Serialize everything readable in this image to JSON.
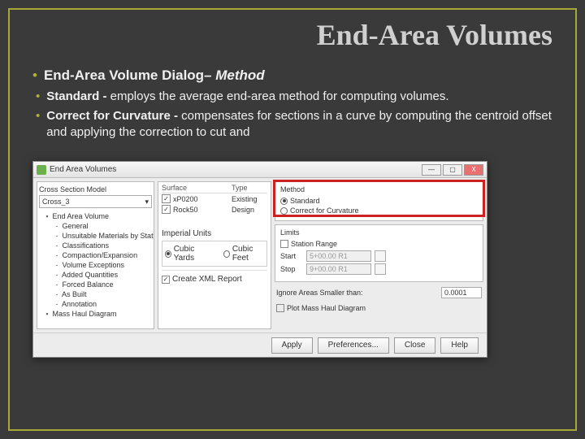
{
  "slide": {
    "title": "End-Area Volumes",
    "b1_label": "End-Area Volume Dialog– ",
    "b1_method": "Method",
    "b2_bold": "Standard - ",
    "b2_text": "employs the average end-area method for computing volumes.",
    "b3_bold": "Correct for Curvature - ",
    "b3_text": "compensates for sections in a curve by computing the centroid offset and applying the correction to cut and"
  },
  "dialog": {
    "title": "End Area Volumes",
    "winbtns": {
      "min": "—",
      "max": "▢",
      "close": "X"
    },
    "tree": {
      "label": "Cross Section Model",
      "select_value": "Cross_3",
      "root": "End Area Volume",
      "children": [
        "General",
        "Unsuitable Materials by Station",
        "Classifications",
        "Compaction/Expansion",
        "Volume Exceptions",
        "Added Quantities",
        "Forced Balance",
        "As Built",
        "Annotation",
        "Mass Haul Diagram"
      ]
    },
    "surfaces": {
      "head_surface": "Surface",
      "head_type": "Type",
      "rows": [
        {
          "checked": true,
          "name": "xP0200",
          "type": "Existing"
        },
        {
          "checked": true,
          "name": "Rock50",
          "type": "Design"
        }
      ]
    },
    "method": {
      "group": "Method",
      "standard": "Standard",
      "correct": "Correct for Curvature"
    },
    "limits": {
      "group": "Limits",
      "station_range": "Station Range",
      "start_label": "Start",
      "stop_label": "Stop",
      "start_value": "5+00.00 R1",
      "stop_value": "9+00.00 R1"
    },
    "units": {
      "group": "Imperial Units",
      "cy": "Cubic Yards",
      "cf": "Cubic Feet"
    },
    "ignore": {
      "label": "Ignore Areas Smaller than:",
      "value": "0.0001"
    },
    "createxml": "Create XML Report",
    "plotmass": "Plot Mass Haul Diagram",
    "buttons": {
      "apply": "Apply",
      "prefs": "Preferences...",
      "close": "Close",
      "help": "Help"
    }
  }
}
